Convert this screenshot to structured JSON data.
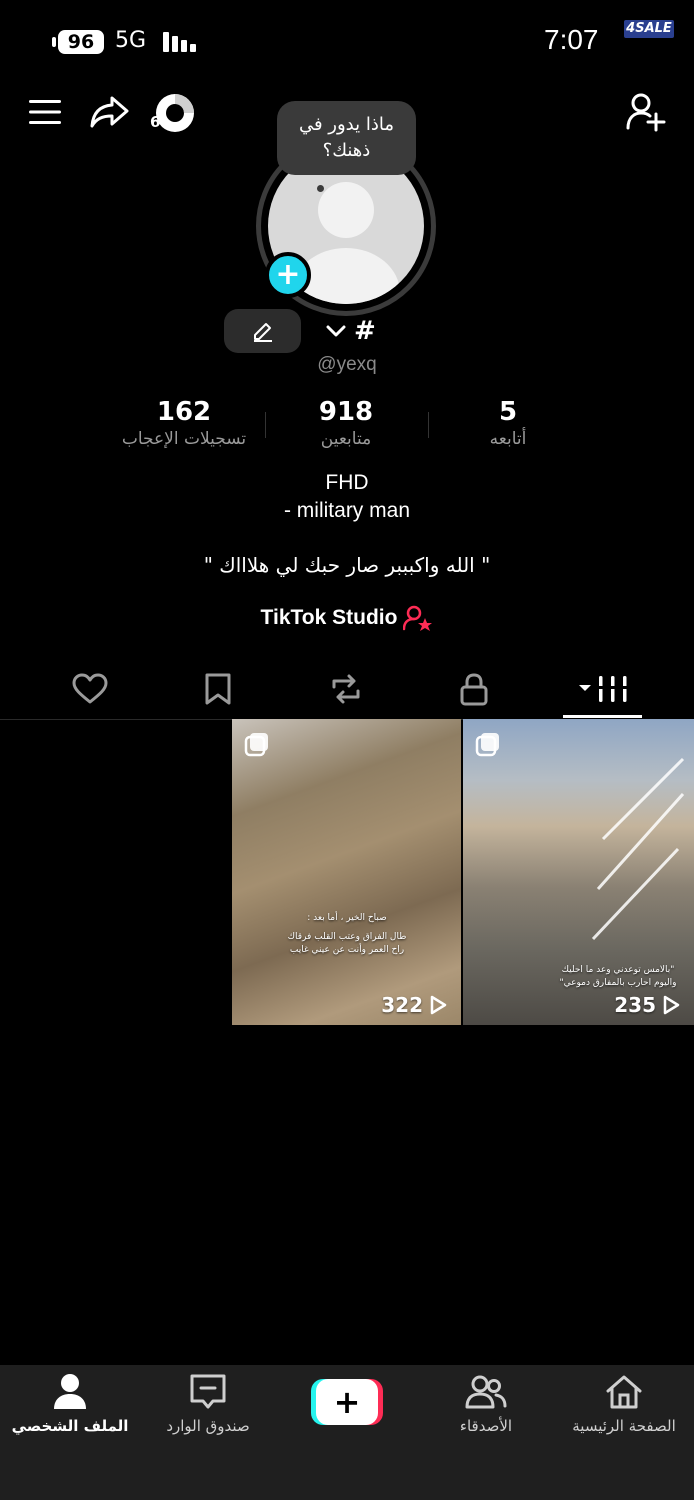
{
  "status_bar": {
    "battery": "96",
    "network": "5G",
    "time": "7:07",
    "watermark": "4SALE"
  },
  "top_bar": {
    "notification_count": "6",
    "icons": [
      "menu-icon",
      "share-icon",
      "activity-ring-icon",
      "add-friend-icon"
    ]
  },
  "profile": {
    "thought_bubble": "ماذا يدور في ذهنك؟",
    "display_name": "#",
    "username": "@yexq",
    "stats": [
      {
        "value": "162",
        "label": "تسجيلات الإعجاب"
      },
      {
        "value": "918",
        "label": "متابعين"
      },
      {
        "value": "5",
        "label": "أتابعه"
      }
    ],
    "bio_line1": "FHD",
    "bio_line2": "- military man",
    "quote": "\" الله واكبببر صار حبك لي هلاااك \"",
    "studio_label": "TikTok Studio"
  },
  "tabs": {
    "items": [
      "liked-tab",
      "saved-tab",
      "reposts-tab",
      "private-tab",
      "videos-tab"
    ],
    "active": "videos-tab"
  },
  "videos": [
    {
      "views": "322",
      "caption_lines": [
        "صباح الخير ، أما بعد :",
        "طال الفراق وعتب القلب فرقاك",
        "راح العمر وأنت عن عيني غايب"
      ]
    },
    {
      "views": "235",
      "caption_lines": [
        "\"بالامس توعدني وعد ما احليك",
        "واليوم احارب بالمفارق دموعي\""
      ]
    }
  ],
  "bottom_nav": {
    "home": "الصفحة الرئيسية",
    "friends": "الأصدقاء",
    "create": "+",
    "inbox": "صندوق الوارد",
    "profile": "الملف الشخصي",
    "active": "profile"
  },
  "colors": {
    "accent_cyan": "#25f4ee",
    "accent_red": "#fe2c55",
    "plus_badge": "#20d5ec"
  }
}
